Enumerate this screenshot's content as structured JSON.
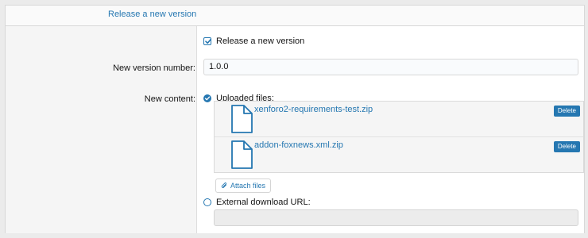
{
  "section_title": "Release a new version",
  "release_checkbox": {
    "label": "Release a new version",
    "checked": true
  },
  "version": {
    "label": "New version number:",
    "value": "1.0.0"
  },
  "content": {
    "label": "New content:",
    "uploaded_option": "Uploaded files:",
    "files": [
      {
        "name": "xenforo2-requirements-test.zip",
        "delete_label": "Delete"
      },
      {
        "name": "addon-foxnews.xml.zip",
        "delete_label": "Delete"
      }
    ],
    "attach_label": "Attach files",
    "external_option": "External download URL:",
    "external_value": ""
  },
  "icons": {
    "checkbox": "checkmark-icon",
    "file": "file-icon",
    "attach": "paperclip-icon"
  },
  "colors": {
    "accent": "#2577b1",
    "label_bg": "#f5f5f5"
  }
}
